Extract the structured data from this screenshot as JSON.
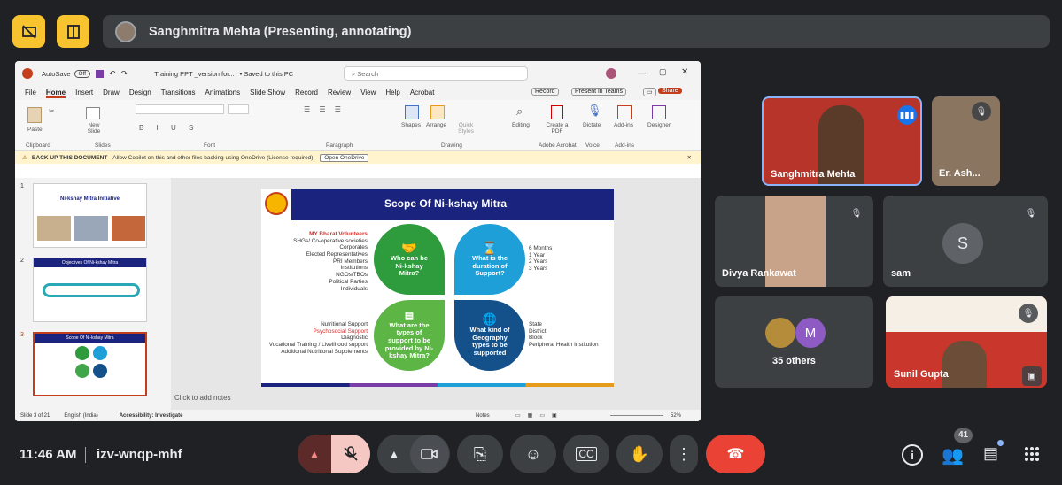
{
  "top": {
    "presenter": "Sanghmitra Mehta (Presenting, annotating)"
  },
  "ppt": {
    "autosave": "AutoSave",
    "autosave_state": "Off",
    "filename": "Training PPT _version for...",
    "saved": "• Saved to this PC",
    "search": "Search",
    "menu": [
      "File",
      "Home",
      "Insert",
      "Draw",
      "Design",
      "Transitions",
      "Animations",
      "Slide Show",
      "Record",
      "Review",
      "View",
      "Help",
      "Acrobat"
    ],
    "record": "Record",
    "present_teams": "Present in Teams",
    "share": "Share",
    "ribbon": {
      "paste": "Paste",
      "clipboard": "Clipboard",
      "new_slide": "New Slide",
      "slides": "Slides",
      "font": "Font",
      "paragraph": "Paragraph",
      "shapes": "Shapes",
      "arrange": "Arrange",
      "quick_styles": "Quick Styles",
      "editing": "Editing",
      "drawing": "Drawing",
      "create_pdf": "Create a PDF",
      "adobe": "Adobe Acrobat",
      "dictate": "Dictate",
      "voice": "Voice",
      "addins": "Add-ins",
      "addins_group": "Add-ins",
      "designer": "Designer"
    },
    "copilot": {
      "title": "BACK UP THIS DOCUMENT",
      "msg": "Allow Copilot on this and other files backing using OneDrive (License required).",
      "btn": "Open OneDrive"
    },
    "thumbs": [
      {
        "num": "1",
        "title": "Ni-kshay Mitra Initiative"
      },
      {
        "num": "2",
        "title": "Objectives Of Ni-kshay Mitra"
      },
      {
        "num": "3",
        "title": "Scope Of Ni-kshay Mitra"
      }
    ],
    "slide": {
      "title": "Scope Of  Ni-kshay Mitra",
      "volunteers_head": "MY Bharat Volunteers",
      "who_list": [
        "SHGs/ Co-operative societies",
        "Corporates",
        "Elected Representatives",
        "PRI Members",
        "Institutions",
        "NGOs/TBOs",
        "Political Parties",
        "Individuals"
      ],
      "q_who": "Who can be Ni-kshay Mitra?",
      "q_duration": "What is the duration of Support?",
      "duration_list": [
        "6 Months",
        "1 Year",
        "2 Years",
        "3 Years"
      ],
      "support_list": [
        "Nutritional Support",
        "Psychosocial Support",
        "Diagnostic",
        "Vocational Training / Livelihood support",
        "Additional Nutritional Supplements"
      ],
      "q_support": "What are the types of support to be provided by Ni-kshay Mitra?",
      "q_geo": "What kind of Geography types to be supported",
      "geo_list": [
        "State",
        "District",
        "Block",
        "Peripheral Health Institution"
      ]
    },
    "notes": "Click to add notes",
    "status": {
      "slide": "Slide 3 of 21",
      "lang": "English (India)",
      "access": "Accessibility: Investigate",
      "notes_btn": "Notes",
      "zoom": "52%"
    }
  },
  "tiles": {
    "sanghmitra": "Sanghmitra Mehta",
    "ash": "Er. Ash...",
    "divya": "Divya Rankawat",
    "sam": "sam",
    "sam_initial": "S",
    "others": "35 others",
    "others_initial": "M",
    "sunil": "Sunil Gupta"
  },
  "bottom": {
    "time": "11:46 AM",
    "code": "izv-wnqp-mhf",
    "people_count": "41"
  },
  "colors": {
    "yellow": "#f7c32e",
    "end_call": "#ea4335",
    "mic_off": "#f5c8c4",
    "ppt_red": "#c43e1c"
  }
}
